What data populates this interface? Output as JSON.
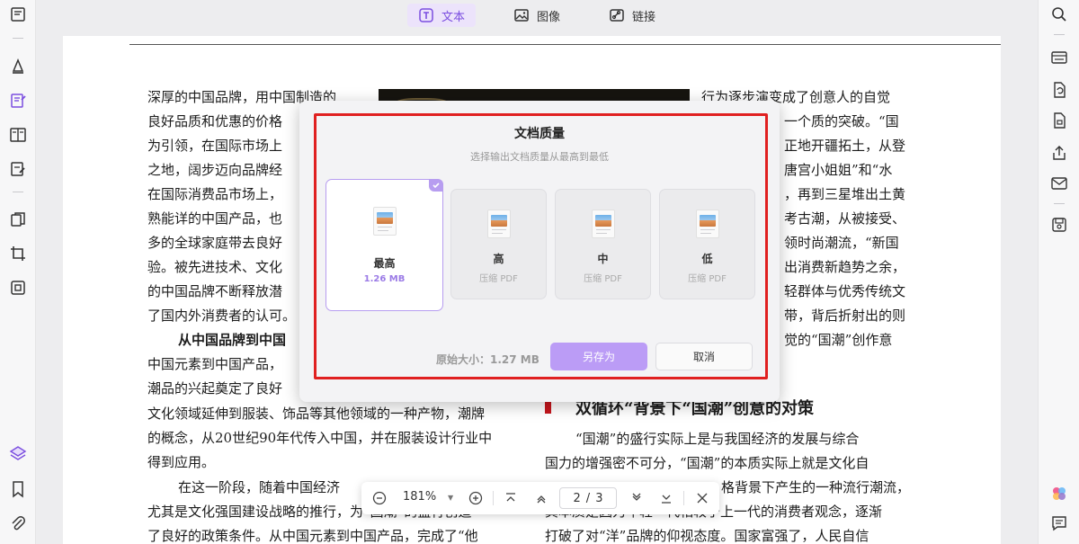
{
  "toolbar": {
    "tabs": [
      {
        "label": "文本",
        "icon": "text-box-icon",
        "active": true
      },
      {
        "label": "图像",
        "icon": "image-icon",
        "active": false
      },
      {
        "label": "链接",
        "icon": "link-icon",
        "active": false
      }
    ]
  },
  "document": {
    "left_column": [
      "深厚的中国品牌，用中国制造的",
      "良好品质和优惠的价格",
      "为引领，在国际市场上",
      "之地，阔步迈向品牌经",
      "在国际消费品市场上，",
      "熟能详的中国产品，也",
      "多的全球家庭带去良好",
      "验。被先进技术、文化",
      "的中国品牌不断释放潜",
      "了国内外消费者的认可。",
      "从中国品牌到中国",
      "中国元素到中国产品，",
      "潮品的兴起奠定了良好",
      "文化领域延伸到服装、饰品等其他领域的一种产物，潮牌",
      "的概念，从20世纪90年代传入中国，并在服装设计行业中",
      "得到应用。",
      "在这一阶段，随着中国经济",
      "尤其是文化强国建设战略的推行，为“国潮”的盛行创造",
      "了良好的政策条件。从中国元素到中国产品，完成了“他"
    ],
    "right_column": [
      "行为逐步演变成了创意人的自觉",
      "一个质的突破。“国",
      "正地开疆拓土，从登",
      "唐宫小姐姐”和“水",
      "，再到三星堆出土黄",
      "考古潮，从被接受、",
      "领时尚潮流，“新国",
      "出消费新趋势之余，",
      "轻群体与优秀传统文",
      "带，背后折射出的则",
      "觉的“国潮”创作意"
    ],
    "heading": "双循环“背景下“国潮”创意的对策",
    "right_column_lower": [
      "“国潮”的盛行实际上是与我国经济的发展与综合",
      "国力的增强密不可分，“国潮”的本质实际上就是文化自",
      "格背景下产生的一种流行潮流，",
      "其本质是因为年轻一代相较于上一代的消费者观念，逐渐",
      "打破了对“洋”品牌的仰视态度。国家富强了，人民自信"
    ]
  },
  "dialog": {
    "title": "文档质量",
    "subtitle": "选择输出文档质量从最高到最低",
    "options": [
      {
        "label": "最高",
        "sub": "1.26 MB",
        "selected": true
      },
      {
        "label": "高",
        "sub": "压缩 PDF",
        "selected": false
      },
      {
        "label": "中",
        "sub": "压缩 PDF",
        "selected": false
      },
      {
        "label": "低",
        "sub": "压缩 PDF",
        "selected": false
      }
    ],
    "original_size": "原始大小：1.27 MB",
    "save_label": "另存为",
    "cancel_label": "取消"
  },
  "zoom_bar": {
    "zoom": "181%",
    "current_page": "2",
    "page_sep": "/",
    "total_pages": "3"
  },
  "colors": {
    "accent": "#7b4ee0",
    "accent_light": "#bb9cf6",
    "highlight_border": "#e02020",
    "heading_marker": "#c5161d"
  }
}
